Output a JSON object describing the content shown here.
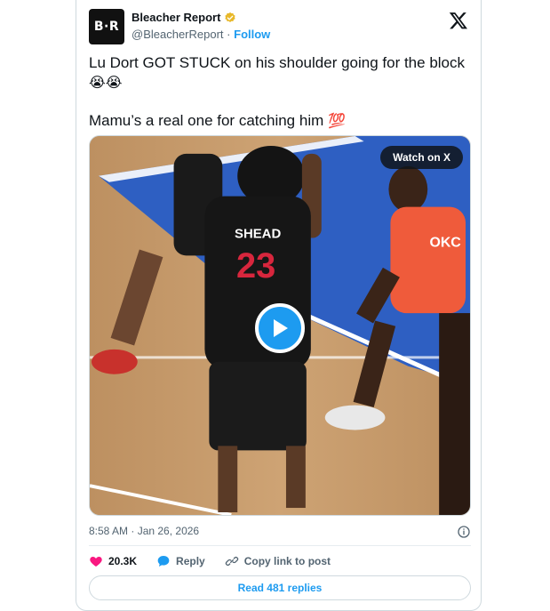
{
  "tweet": {
    "author": {
      "avatar_text": "B·R",
      "name": "Bleacher Report",
      "handle": "@BleacherReport",
      "separator": "·",
      "follow_label": "Follow",
      "verified_color": "#e8b829"
    },
    "text_line1": "Lu Dort GOT STUCK on his shoulder going for the block",
    "text_line1_emoji": "😭😭",
    "text_line2": "Mamu’s a real one for catching him",
    "text_line2_emoji": "💯",
    "media": {
      "watch_label": "Watch on X",
      "jersey_name": "SHEAD",
      "jersey_number": "23",
      "opponent_jersey_text": "OKC"
    },
    "timestamp": "8:58 AM · Jan 26, 2026",
    "actions": {
      "likes": "20.3K",
      "reply_label": "Reply",
      "copy_label": "Copy link to post"
    },
    "read_replies_label": "Read 481 replies"
  },
  "colors": {
    "accent": "#1d9bf0",
    "like": "#f91880",
    "text": "#0f1419",
    "muted": "#536471"
  }
}
